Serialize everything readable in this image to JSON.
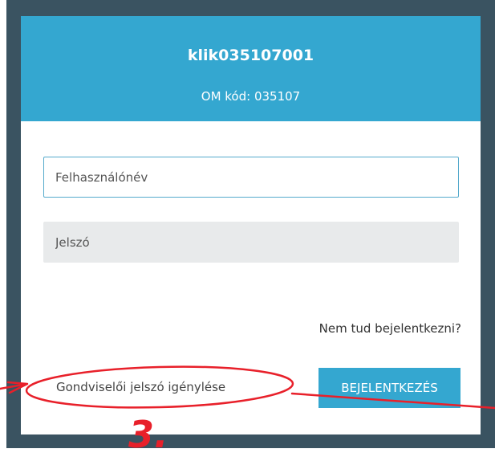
{
  "header": {
    "school_name": "klik035107001",
    "om_code": "OM kód: 035107"
  },
  "login_form": {
    "username_placeholder": "Felhasználónév",
    "password_placeholder": "Jelszó",
    "forgot_link": "Nem tud bejelentkezni?",
    "guardian_link": "Gondviselői jelszó igénylése",
    "login_button": "BEJELENTKEZÉS"
  },
  "annotation": {
    "step_number": "3.",
    "color": "#e8202a"
  },
  "colors": {
    "header_bg": "#34a7d0",
    "button_bg": "#34a7d0",
    "backdrop": "#3a5361"
  }
}
